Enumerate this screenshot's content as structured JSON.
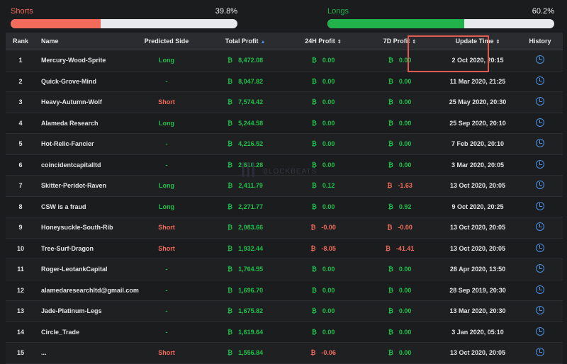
{
  "ratio": {
    "shorts": {
      "label": "Shorts",
      "pct_text": "39.8%",
      "fraction": 0.398
    },
    "longs": {
      "label": "Longs",
      "pct_text": "60.2%",
      "fraction": 0.602
    }
  },
  "table": {
    "headers": {
      "rank": "Rank",
      "name": "Name",
      "side": "Predicted Side",
      "total": "Total Profit",
      "h24": "24H Profit",
      "d7": "7D Profit",
      "update": "Update Time",
      "history": "History"
    },
    "currency_symbol": "₿",
    "rows": [
      {
        "rank": "1",
        "name": "Mercury-Wood-Sprite",
        "side": "Long",
        "total": "8,472.08",
        "h24": "0.00",
        "d7": "0.00",
        "time": "2 Oct 2020, 20:15"
      },
      {
        "rank": "2",
        "name": "Quick-Grove-Mind",
        "side": "-",
        "total": "8,047.82",
        "h24": "0.00",
        "d7": "0.00",
        "time": "11 Mar 2020, 21:25"
      },
      {
        "rank": "3",
        "name": "Heavy-Autumn-Wolf",
        "side": "Short",
        "total": "7,574.42",
        "h24": "0.00",
        "d7": "0.00",
        "time": "25 May 2020, 20:30"
      },
      {
        "rank": "4",
        "name": "Alameda Research",
        "side": "Long",
        "total": "5,244.58",
        "h24": "0.00",
        "d7": "0.00",
        "time": "25 Sep 2020, 20:10"
      },
      {
        "rank": "5",
        "name": "Hot-Relic-Fancier",
        "side": "-",
        "total": "4,216.52",
        "h24": "0.00",
        "d7": "0.00",
        "time": "7 Feb 2020, 20:10"
      },
      {
        "rank": "6",
        "name": "coincidentcapitalltd",
        "side": "-",
        "total": "2,610.28",
        "h24": "0.00",
        "d7": "0.00",
        "time": "3 Mar 2020, 20:05"
      },
      {
        "rank": "7",
        "name": "Skitter-Peridot-Raven",
        "side": "Long",
        "total": "2,411.79",
        "h24": "0.12",
        "d7": "-1.63",
        "time": "13 Oct 2020, 20:05"
      },
      {
        "rank": "8",
        "name": "CSW is a fraud",
        "side": "Long",
        "total": "2,271.77",
        "h24": "0.00",
        "d7": "0.92",
        "time": "9 Oct 2020, 20:25"
      },
      {
        "rank": "9",
        "name": "Honeysuckle-South-Rib",
        "side": "Short",
        "total": "2,083.66",
        "h24": "-0.00",
        "d7": "-0.00",
        "time": "13 Oct 2020, 20:05"
      },
      {
        "rank": "10",
        "name": "Tree-Surf-Dragon",
        "side": "Short",
        "total": "1,932.44",
        "h24": "-8.05",
        "d7": "-41.41",
        "time": "13 Oct 2020, 20:05"
      },
      {
        "rank": "11",
        "name": "Roger-LeotankCapital",
        "side": "-",
        "total": "1,764.55",
        "h24": "0.00",
        "d7": "0.00",
        "time": "28 Apr 2020, 13:50"
      },
      {
        "rank": "12",
        "name": "alamedaresearchltd@gmail.com",
        "side": "-",
        "total": "1,696.70",
        "h24": "0.00",
        "d7": "0.00",
        "time": "28 Sep 2019, 20:30"
      },
      {
        "rank": "13",
        "name": "Jade-Platinum-Legs",
        "side": "-",
        "total": "1,675.82",
        "h24": "0.00",
        "d7": "0.00",
        "time": "13 Mar 2020, 20:30"
      },
      {
        "rank": "14",
        "name": "Circle_Trade",
        "side": "-",
        "total": "1,619.64",
        "h24": "0.00",
        "d7": "0.00",
        "time": "3 Jan 2020, 05:10"
      },
      {
        "rank": "15",
        "name": "...",
        "side": "Short",
        "total": "1,556.84",
        "h24": "-0.06",
        "d7": "0.00",
        "time": "13 Oct 2020, 20:05"
      }
    ]
  },
  "watermark": {
    "mark": "|||",
    "text": "BLOCKBEATS"
  },
  "colors": {
    "long": "#1fbf4a",
    "short": "#f26b5b",
    "accent": "#4a8fe3",
    "highlight": "#e05a4f"
  }
}
